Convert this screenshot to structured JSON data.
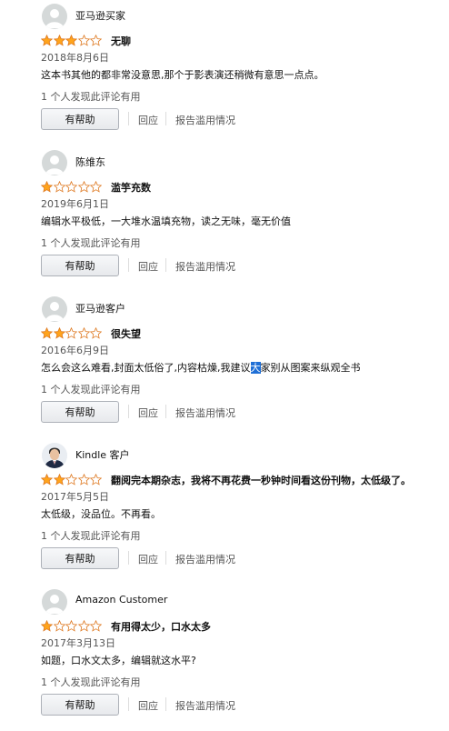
{
  "colors": {
    "star_filled": "#ffa41c",
    "star_stroke": "#de7921",
    "highlight": "#1f6fd6"
  },
  "reviews": [
    {
      "author": "亚马逊买家",
      "avatar_icon": "default-user-icon",
      "rating": 3,
      "title": "无聊",
      "date": "2018年8月6日",
      "body": "这本书其他的都非常没意思,那个于影表演还稍微有意思一点点。",
      "helpful_text": "1 个人发现此评论有用",
      "helpful_button": "有帮助",
      "reply_label": "回应",
      "report_label": "报告滥用情况"
    },
    {
      "author": "陈维东",
      "avatar_icon": "default-user-icon",
      "rating": 1,
      "title": "滥竽充数",
      "date": "2019年6月1日",
      "body": "编辑水平极低，一大堆水温填充物，读之无味，毫无价值",
      "helpful_text": "1 个人发现此评论有用",
      "helpful_button": "有帮助",
      "reply_label": "回应",
      "report_label": "报告滥用情况"
    },
    {
      "author": "亚马逊客户",
      "avatar_icon": "default-user-icon",
      "rating": 2,
      "title": "很失望",
      "date": "2016年6月9日",
      "body_before": "怎么会这么难看,封面太低俗了,内容枯燥,我建议",
      "body_highlight": "大",
      "body_after": "家别从图案来纵观全书",
      "helpful_text": "1 个人发现此评论有用",
      "helpful_button": "有帮助",
      "reply_label": "回应",
      "report_label": "报告滥用情况"
    },
    {
      "author": "Kindle 客户",
      "avatar_icon": "user-photo-icon",
      "rating": 2,
      "title": "翻阅完本期杂志，我将不再花费一秒钟时间看这份刊物，太低级了。",
      "date": "2017年5月5日",
      "body": "太低级，没品位。不再看。",
      "helpful_text": "1 个人发现此评论有用",
      "helpful_button": "有帮助",
      "reply_label": "回应",
      "report_label": "报告滥用情况"
    },
    {
      "author": "Amazon Customer",
      "avatar_icon": "default-user-icon",
      "rating": 1,
      "title": "有用得太少，口水太多",
      "date": "2017年3月13日",
      "body": "如题，口水文太多，编辑就这水平?",
      "helpful_text": "1 个人发现此评论有用",
      "helpful_button": "有帮助",
      "reply_label": "回应",
      "report_label": "报告滥用情况"
    }
  ]
}
